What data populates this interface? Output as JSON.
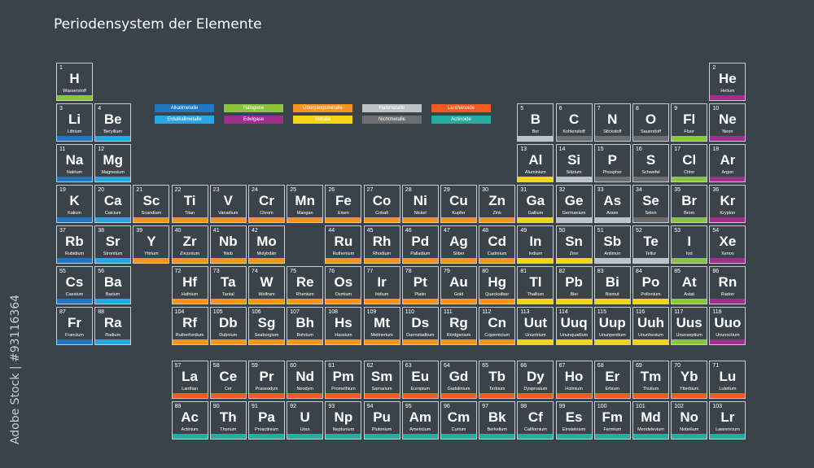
{
  "page": {
    "title": "Periodensystem der Elemente",
    "stock_id": "Adobe Stock | #93116364"
  },
  "category_colors": {
    "alkali": "#1f77c4",
    "alkaline": "#26a6e4",
    "halogen": "#8bc53f",
    "noble": "#a12d8e",
    "transition": "#f7941d",
    "metal": "#f3d318",
    "metalloid": "#bcc3c8",
    "nonmetal": "#6d6e70",
    "lanthanide": "#f15a24",
    "actinide": "#27aaa0"
  },
  "legend": [
    {
      "label": "Alkalimetalle",
      "cat": "alkali"
    },
    {
      "label": "Halogene",
      "cat": "halogen"
    },
    {
      "label": "Übergangsmetalle",
      "cat": "transition"
    },
    {
      "label": "Halbmetalle",
      "cat": "metalloid"
    },
    {
      "label": "Lanthanoide",
      "cat": "lanthanide"
    },
    {
      "label": "Erdalkalimetalle",
      "cat": "alkaline"
    },
    {
      "label": "Edelgase",
      "cat": "noble"
    },
    {
      "label": "Metalle",
      "cat": "metal"
    },
    {
      "label": "Nichtmetalle",
      "cat": "nonmetal"
    },
    {
      "label": "Actinoide",
      "cat": "actinide"
    }
  ],
  "elements": [
    [
      "1",
      "H",
      "Wasserstoff",
      1,
      1,
      "halogen"
    ],
    [
      "2",
      "He",
      "Helium",
      18,
      1,
      "noble"
    ],
    [
      "3",
      "Li",
      "Lithium",
      1,
      2,
      "alkali"
    ],
    [
      "4",
      "Be",
      "Beryllium",
      2,
      2,
      "alkaline"
    ],
    [
      "5",
      "B",
      "Bor",
      13,
      2,
      "metalloid"
    ],
    [
      "6",
      "C",
      "Kohlenstoff",
      14,
      2,
      "nonmetal"
    ],
    [
      "7",
      "N",
      "Stickstoff",
      15,
      2,
      "nonmetal"
    ],
    [
      "8",
      "O",
      "Sauerstoff",
      16,
      2,
      "nonmetal"
    ],
    [
      "9",
      "Fl",
      "Fluor",
      17,
      2,
      "halogen"
    ],
    [
      "10",
      "Ne",
      "Neon",
      18,
      2,
      "noble"
    ],
    [
      "11",
      "Na",
      "Natrium",
      1,
      3,
      "alkali"
    ],
    [
      "12",
      "Mg",
      "Magnesium",
      2,
      3,
      "alkaline"
    ],
    [
      "13",
      "Al",
      "Aluminium",
      13,
      3,
      "metal"
    ],
    [
      "14",
      "Si",
      "Silizium",
      14,
      3,
      "metalloid"
    ],
    [
      "15",
      "P",
      "Phosphor",
      15,
      3,
      "nonmetal"
    ],
    [
      "16",
      "S",
      "Schwefel",
      16,
      3,
      "nonmetal"
    ],
    [
      "17",
      "Cl",
      "Chlor",
      17,
      3,
      "halogen"
    ],
    [
      "18",
      "Ar",
      "Argon",
      18,
      3,
      "noble"
    ],
    [
      "19",
      "K",
      "Kalium",
      1,
      4,
      "alkali"
    ],
    [
      "20",
      "Ca",
      "Calcium",
      2,
      4,
      "alkaline"
    ],
    [
      "21",
      "Sc",
      "Scandium",
      3,
      4,
      "transition"
    ],
    [
      "22",
      "Ti",
      "Titan",
      4,
      4,
      "transition"
    ],
    [
      "23",
      "V",
      "Vanadium",
      5,
      4,
      "transition"
    ],
    [
      "24",
      "Cr",
      "Chrom",
      6,
      4,
      "transition"
    ],
    [
      "25",
      "Mn",
      "Mangan",
      7,
      4,
      "transition"
    ],
    [
      "26",
      "Fe",
      "Eisen",
      8,
      4,
      "transition"
    ],
    [
      "27",
      "Co",
      "Cobalt",
      9,
      4,
      "transition"
    ],
    [
      "28",
      "Ni",
      "Nickel",
      10,
      4,
      "transition"
    ],
    [
      "29",
      "Cu",
      "Kupfer",
      11,
      4,
      "transition"
    ],
    [
      "30",
      "Zn",
      "Zink",
      12,
      4,
      "transition"
    ],
    [
      "31",
      "Ga",
      "Gallium",
      13,
      4,
      "metal"
    ],
    [
      "32",
      "Ge",
      "Germanium",
      14,
      4,
      "metalloid"
    ],
    [
      "33",
      "As",
      "Arsen",
      15,
      4,
      "metalloid"
    ],
    [
      "34",
      "Se",
      "Selen",
      16,
      4,
      "nonmetal"
    ],
    [
      "35",
      "Br",
      "Brom",
      17,
      4,
      "halogen"
    ],
    [
      "36",
      "Kr",
      "Krypton",
      18,
      4,
      "noble"
    ],
    [
      "37",
      "Rb",
      "Rubidium",
      1,
      5,
      "alkali"
    ],
    [
      "38",
      "Sr",
      "Strontium",
      2,
      5,
      "alkaline"
    ],
    [
      "39",
      "Y",
      "Yttrium",
      3,
      5,
      "transition"
    ],
    [
      "40",
      "Zr",
      "Zirconium",
      4,
      5,
      "transition"
    ],
    [
      "41",
      "Nb",
      "Niob",
      5,
      5,
      "transition"
    ],
    [
      "42",
      "Mo",
      "Molybdän",
      6,
      5,
      "transition"
    ],
    [
      "44",
      "Ru",
      "Ruthenium",
      8,
      5,
      "transition"
    ],
    [
      "45",
      "Rh",
      "Rhodium",
      9,
      5,
      "transition"
    ],
    [
      "46",
      "Pd",
      "Palladium",
      10,
      5,
      "transition"
    ],
    [
      "47",
      "Ag",
      "Silber",
      11,
      5,
      "transition"
    ],
    [
      "48",
      "Cd",
      "Cadmium",
      12,
      5,
      "transition"
    ],
    [
      "49",
      "In",
      "Indium",
      13,
      5,
      "metal"
    ],
    [
      "50",
      "Sn",
      "Zinn",
      14,
      5,
      "metal"
    ],
    [
      "51",
      "Sb",
      "Antimon",
      15,
      5,
      "metalloid"
    ],
    [
      "52",
      "Te",
      "Tellur",
      16,
      5,
      "metalloid"
    ],
    [
      "53",
      "I",
      "Iod",
      17,
      5,
      "halogen"
    ],
    [
      "54",
      "Xe",
      "Xenon",
      18,
      5,
      "noble"
    ],
    [
      "55",
      "Cs",
      "Caesium",
      1,
      6,
      "alkali"
    ],
    [
      "56",
      "Ba",
      "Barium",
      2,
      6,
      "alkaline"
    ],
    [
      "72",
      "Hf",
      "Hafnium",
      4,
      6,
      "transition"
    ],
    [
      "73",
      "Ta",
      "Tantal",
      5,
      6,
      "transition"
    ],
    [
      "74",
      "W",
      "Wolfram",
      6,
      6,
      "transition"
    ],
    [
      "75",
      "Re",
      "Rhenium",
      7,
      6,
      "transition"
    ],
    [
      "76",
      "Os",
      "Osmium",
      8,
      6,
      "transition"
    ],
    [
      "77",
      "Ir",
      "Iridium",
      9,
      6,
      "transition"
    ],
    [
      "78",
      "Pt",
      "Platin",
      10,
      6,
      "transition"
    ],
    [
      "79",
      "Au",
      "Gold",
      11,
      6,
      "transition"
    ],
    [
      "80",
      "Hg",
      "Quecksilber",
      12,
      6,
      "transition"
    ],
    [
      "81",
      "Tl",
      "Thallium",
      13,
      6,
      "metal"
    ],
    [
      "82",
      "Pb",
      "Blei",
      14,
      6,
      "metal"
    ],
    [
      "83",
      "Bi",
      "Bismut",
      15,
      6,
      "metal"
    ],
    [
      "84",
      "Po",
      "Pollonium",
      16,
      6,
      "metal"
    ],
    [
      "85",
      "At",
      "Astat",
      17,
      6,
      "halogen"
    ],
    [
      "86",
      "Rn",
      "Radon",
      18,
      6,
      "noble"
    ],
    [
      "87",
      "Fr",
      "Francium",
      1,
      7,
      "alkali"
    ],
    [
      "88",
      "Ra",
      "Radium",
      2,
      7,
      "alkaline"
    ],
    [
      "104",
      "Rf",
      "Rutherfordium",
      4,
      7,
      "transition"
    ],
    [
      "105",
      "Db",
      "Dubnium",
      5,
      7,
      "transition"
    ],
    [
      "106",
      "Sg",
      "Seaborgium",
      6,
      7,
      "transition"
    ],
    [
      "107",
      "Bh",
      "Bohrium",
      7,
      7,
      "transition"
    ],
    [
      "108",
      "Hs",
      "Hassium",
      8,
      7,
      "transition"
    ],
    [
      "109",
      "Mt",
      "Meitnerium",
      9,
      7,
      "transition"
    ],
    [
      "110",
      "Ds",
      "Darmstadtium",
      10,
      7,
      "transition"
    ],
    [
      "111",
      "Rg",
      "Röntgenium",
      11,
      7,
      "transition"
    ],
    [
      "112",
      "Cn",
      "Copernicium",
      12,
      7,
      "transition"
    ],
    [
      "113",
      "Uut",
      "Ununtrium",
      13,
      7,
      "metal"
    ],
    [
      "114",
      "Uuq",
      "Ununquadium",
      14,
      7,
      "metal"
    ],
    [
      "115",
      "Uup",
      "Ununpentium",
      15,
      7,
      "metal"
    ],
    [
      "116",
      "Uuh",
      "Ununhexium",
      16,
      7,
      "metal"
    ],
    [
      "117",
      "Uus",
      "Ununseptium",
      17,
      7,
      "halogen"
    ],
    [
      "118",
      "Uuo",
      "Ununoctium",
      18,
      7,
      "noble"
    ],
    [
      "57",
      "La",
      "Lanthan",
      4,
      9,
      "lanthanide"
    ],
    [
      "58",
      "Ce",
      "Cer",
      5,
      9,
      "lanthanide"
    ],
    [
      "59",
      "Pr",
      "Praseodym",
      6,
      9,
      "lanthanide"
    ],
    [
      "60",
      "Nd",
      "Neodym",
      7,
      9,
      "lanthanide"
    ],
    [
      "61",
      "Pm",
      "Promethium",
      8,
      9,
      "lanthanide"
    ],
    [
      "62",
      "Sm",
      "Samarium",
      9,
      9,
      "lanthanide"
    ],
    [
      "63",
      "Eu",
      "Europium",
      10,
      9,
      "lanthanide"
    ],
    [
      "64",
      "Gd",
      "Gadolinium",
      11,
      9,
      "lanthanide"
    ],
    [
      "65",
      "Tb",
      "Terbium",
      12,
      9,
      "lanthanide"
    ],
    [
      "66",
      "Dy",
      "Dysprosium",
      13,
      9,
      "lanthanide"
    ],
    [
      "67",
      "Ho",
      "Holmium",
      14,
      9,
      "lanthanide"
    ],
    [
      "68",
      "Er",
      "Erbium",
      15,
      9,
      "lanthanide"
    ],
    [
      "69",
      "Tm",
      "Thulium",
      16,
      9,
      "lanthanide"
    ],
    [
      "70",
      "Yb",
      "Ytterbium",
      17,
      9,
      "lanthanide"
    ],
    [
      "71",
      "Lu",
      "Lutetium",
      18,
      9,
      "lanthanide"
    ],
    [
      "89",
      "Ac",
      "Actinium",
      4,
      10,
      "actinide"
    ],
    [
      "90",
      "Th",
      "Thorium",
      5,
      10,
      "actinide"
    ],
    [
      "91",
      "Pa",
      "Proactinium",
      6,
      10,
      "actinide"
    ],
    [
      "92",
      "U",
      "Uran",
      7,
      10,
      "actinide"
    ],
    [
      "93",
      "Np",
      "Neptunium",
      8,
      10,
      "actinide"
    ],
    [
      "94",
      "Pu",
      "Plutonium",
      9,
      10,
      "actinide"
    ],
    [
      "95",
      "Am",
      "Americium",
      10,
      10,
      "actinide"
    ],
    [
      "96",
      "Cm",
      "Curium",
      11,
      10,
      "actinide"
    ],
    [
      "97",
      "Bk",
      "Berkelium",
      12,
      10,
      "actinide"
    ],
    [
      "98",
      "Cf",
      "Californium",
      13,
      10,
      "actinide"
    ],
    [
      "99",
      "Es",
      "Einsteinium",
      14,
      10,
      "actinide"
    ],
    [
      "100",
      "Fm",
      "Fermium",
      15,
      10,
      "actinide"
    ],
    [
      "101",
      "Md",
      "Mendelevium",
      16,
      10,
      "actinide"
    ],
    [
      "102",
      "No",
      "Nobelium",
      17,
      10,
      "actinide"
    ],
    [
      "103",
      "Lr",
      "Lawrencium",
      18,
      10,
      "actinide"
    ]
  ]
}
